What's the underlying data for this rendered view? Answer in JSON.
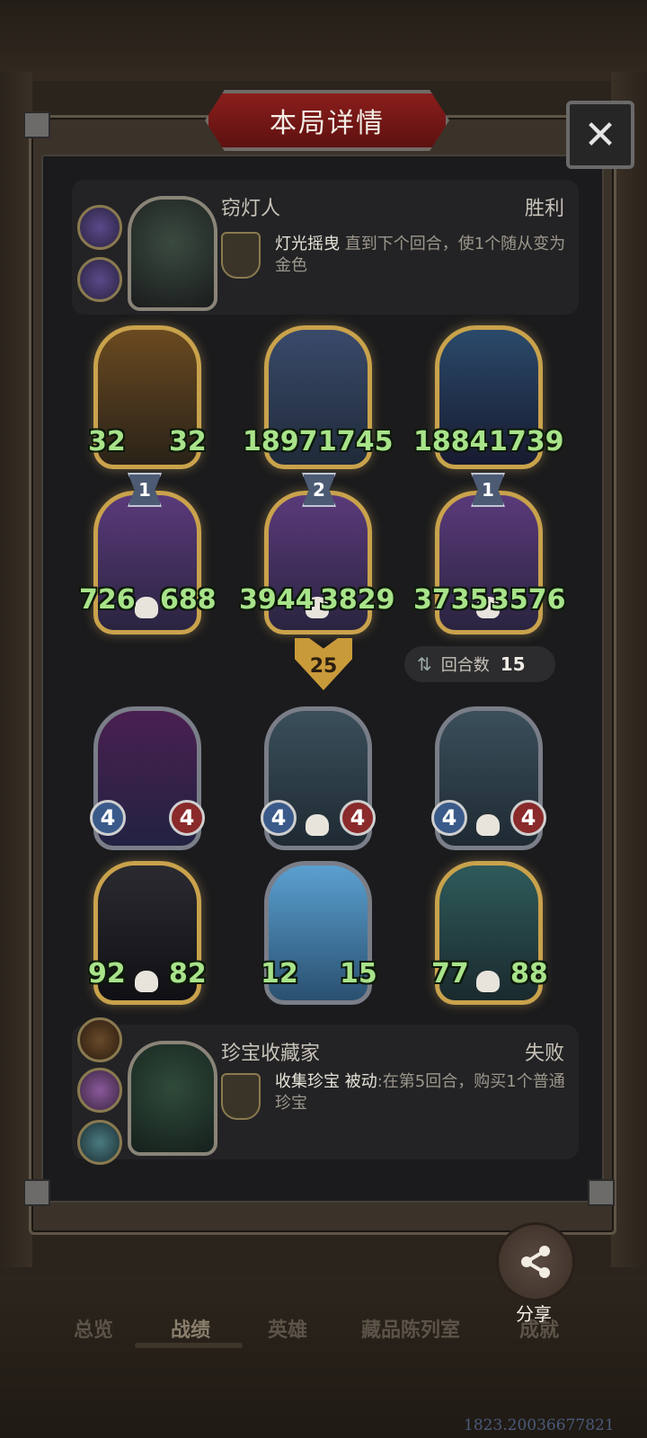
{
  "title": "本局详情",
  "close_glyph": "✕",
  "player_top": {
    "name": "窃灯人",
    "result": "胜利",
    "skill_name": "灯光摇曳",
    "skill_desc": "直到下个回合，使1个随从变为金色"
  },
  "top_board": {
    "row1": [
      {
        "atk": "32",
        "hp": "32"
      },
      {
        "atk": "1897",
        "hp": "1745"
      },
      {
        "atk": "1884",
        "hp": "1739"
      }
    ],
    "row2": [
      {
        "tier": "1",
        "atk": "726",
        "hp": "688"
      },
      {
        "tier": "2",
        "atk": "3944",
        "hp": "3829"
      },
      {
        "tier": "1",
        "atk": "3735",
        "hp": "3576"
      }
    ]
  },
  "damage": "25",
  "rounds": {
    "label": "回合数",
    "value": "15"
  },
  "bottom_board": {
    "row1": [
      {
        "atk": "4",
        "hp": "4"
      },
      {
        "atk": "4",
        "hp": "4"
      },
      {
        "atk": "4",
        "hp": "4"
      }
    ],
    "row2": [
      {
        "atk": "92",
        "hp": "82"
      },
      {
        "atk": "12",
        "hp": "15"
      },
      {
        "atk": "77",
        "hp": "88"
      }
    ]
  },
  "player_bottom": {
    "name": "珍宝收藏家",
    "result": "失败",
    "skill_name": "收集珍宝",
    "skill_passive": "被动",
    "skill_desc": ":在第5回合，购买1个普通珍宝"
  },
  "share_label": "分享",
  "nav": [
    "总览",
    "战绩",
    "英雄",
    "藏品陈列室",
    "成就"
  ],
  "footer_id": "1823.20036677821"
}
